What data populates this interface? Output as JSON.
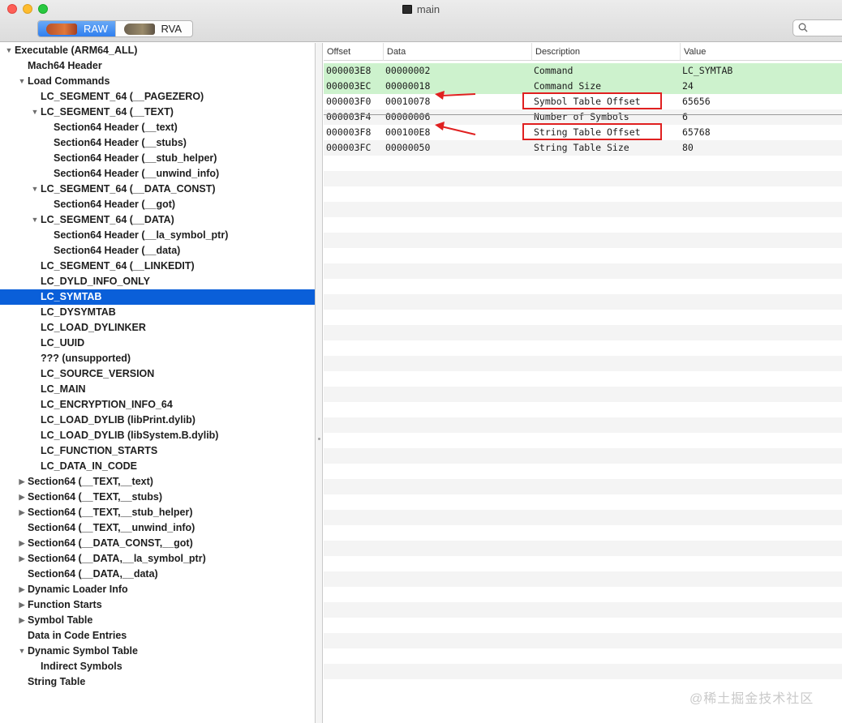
{
  "window": {
    "title": "main"
  },
  "toolbar": {
    "raw_label": "RAW",
    "rva_label": "RVA",
    "search": {
      "placeholder": ""
    }
  },
  "tree": [
    {
      "label": "Executable  (ARM64_ALL)",
      "level": 0,
      "disclosure": "open"
    },
    {
      "label": "Mach64 Header",
      "level": 1,
      "disclosure": "none"
    },
    {
      "label": "Load Commands",
      "level": 1,
      "disclosure": "open"
    },
    {
      "label": "LC_SEGMENT_64 (__PAGEZERO)",
      "level": 2,
      "disclosure": "none"
    },
    {
      "label": "LC_SEGMENT_64 (__TEXT)",
      "level": 2,
      "disclosure": "open"
    },
    {
      "label": "Section64 Header (__text)",
      "level": 3,
      "disclosure": "none"
    },
    {
      "label": "Section64 Header (__stubs)",
      "level": 3,
      "disclosure": "none"
    },
    {
      "label": "Section64 Header (__stub_helper)",
      "level": 3,
      "disclosure": "none"
    },
    {
      "label": "Section64 Header (__unwind_info)",
      "level": 3,
      "disclosure": "none"
    },
    {
      "label": "LC_SEGMENT_64 (__DATA_CONST)",
      "level": 2,
      "disclosure": "open"
    },
    {
      "label": "Section64 Header (__got)",
      "level": 3,
      "disclosure": "none"
    },
    {
      "label": "LC_SEGMENT_64 (__DATA)",
      "level": 2,
      "disclosure": "open"
    },
    {
      "label": "Section64 Header (__la_symbol_ptr)",
      "level": 3,
      "disclosure": "none"
    },
    {
      "label": "Section64 Header (__data)",
      "level": 3,
      "disclosure": "none"
    },
    {
      "label": "LC_SEGMENT_64 (__LINKEDIT)",
      "level": 2,
      "disclosure": "none"
    },
    {
      "label": "LC_DYLD_INFO_ONLY",
      "level": 2,
      "disclosure": "none"
    },
    {
      "label": "LC_SYMTAB",
      "level": 2,
      "disclosure": "none",
      "selected": true
    },
    {
      "label": "LC_DYSYMTAB",
      "level": 2,
      "disclosure": "none"
    },
    {
      "label": "LC_LOAD_DYLINKER",
      "level": 2,
      "disclosure": "none"
    },
    {
      "label": "LC_UUID",
      "level": 2,
      "disclosure": "none"
    },
    {
      "label": "??? (unsupported)",
      "level": 2,
      "disclosure": "none"
    },
    {
      "label": "LC_SOURCE_VERSION",
      "level": 2,
      "disclosure": "none"
    },
    {
      "label": "LC_MAIN",
      "level": 2,
      "disclosure": "none"
    },
    {
      "label": "LC_ENCRYPTION_INFO_64",
      "level": 2,
      "disclosure": "none"
    },
    {
      "label": "LC_LOAD_DYLIB (libPrint.dylib)",
      "level": 2,
      "disclosure": "none"
    },
    {
      "label": "LC_LOAD_DYLIB (libSystem.B.dylib)",
      "level": 2,
      "disclosure": "none"
    },
    {
      "label": "LC_FUNCTION_STARTS",
      "level": 2,
      "disclosure": "none"
    },
    {
      "label": "LC_DATA_IN_CODE",
      "level": 2,
      "disclosure": "none"
    },
    {
      "label": "Section64 (__TEXT,__text)",
      "level": 1,
      "disclosure": "closed"
    },
    {
      "label": "Section64 (__TEXT,__stubs)",
      "level": 1,
      "disclosure": "closed"
    },
    {
      "label": "Section64 (__TEXT,__stub_helper)",
      "level": 1,
      "disclosure": "closed"
    },
    {
      "label": "Section64 (__TEXT,__unwind_info)",
      "level": 1,
      "disclosure": "none"
    },
    {
      "label": "Section64 (__DATA_CONST,__got)",
      "level": 1,
      "disclosure": "closed"
    },
    {
      "label": "Section64 (__DATA,__la_symbol_ptr)",
      "level": 1,
      "disclosure": "closed"
    },
    {
      "label": "Section64 (__DATA,__data)",
      "level": 1,
      "disclosure": "none"
    },
    {
      "label": "Dynamic Loader Info",
      "level": 1,
      "disclosure": "closed"
    },
    {
      "label": "Function Starts",
      "level": 1,
      "disclosure": "closed"
    },
    {
      "label": "Symbol Table",
      "level": 1,
      "disclosure": "closed"
    },
    {
      "label": "Data in Code Entries",
      "level": 1,
      "disclosure": "none"
    },
    {
      "label": "Dynamic Symbol Table",
      "level": 1,
      "disclosure": "open"
    },
    {
      "label": "Indirect Symbols",
      "level": 2,
      "disclosure": "none"
    },
    {
      "label": "String Table",
      "level": 1,
      "disclosure": "none"
    }
  ],
  "table": {
    "columns": [
      "Offset",
      "Data",
      "Description",
      "Value"
    ],
    "rows": [
      {
        "offset": "000003E8",
        "data": "00000002",
        "description": "Command",
        "value": "LC_SYMTAB",
        "highlight": true
      },
      {
        "offset": "000003EC",
        "data": "00000018",
        "description": "Command Size",
        "value": "24",
        "highlight": true
      },
      {
        "offset": "000003F0",
        "data": "00010078",
        "description": "Symbol Table Offset",
        "value": "65656",
        "annotated": true
      },
      {
        "offset": "000003F4",
        "data": "00000006",
        "description": "Number of Symbols",
        "value": "6"
      },
      {
        "offset": "000003F8",
        "data": "000100E8",
        "description": "String Table Offset",
        "value": "65768",
        "annotated": true
      },
      {
        "offset": "000003FC",
        "data": "00000050",
        "description": "String Table Size",
        "value": "80"
      }
    ],
    "empty_rows": 34
  },
  "watermark": "@稀土掘金技术社区",
  "colors": {
    "selection": "#0a5fd9",
    "highlight_row": "#cdf2cd",
    "annotation": "#e02020"
  }
}
